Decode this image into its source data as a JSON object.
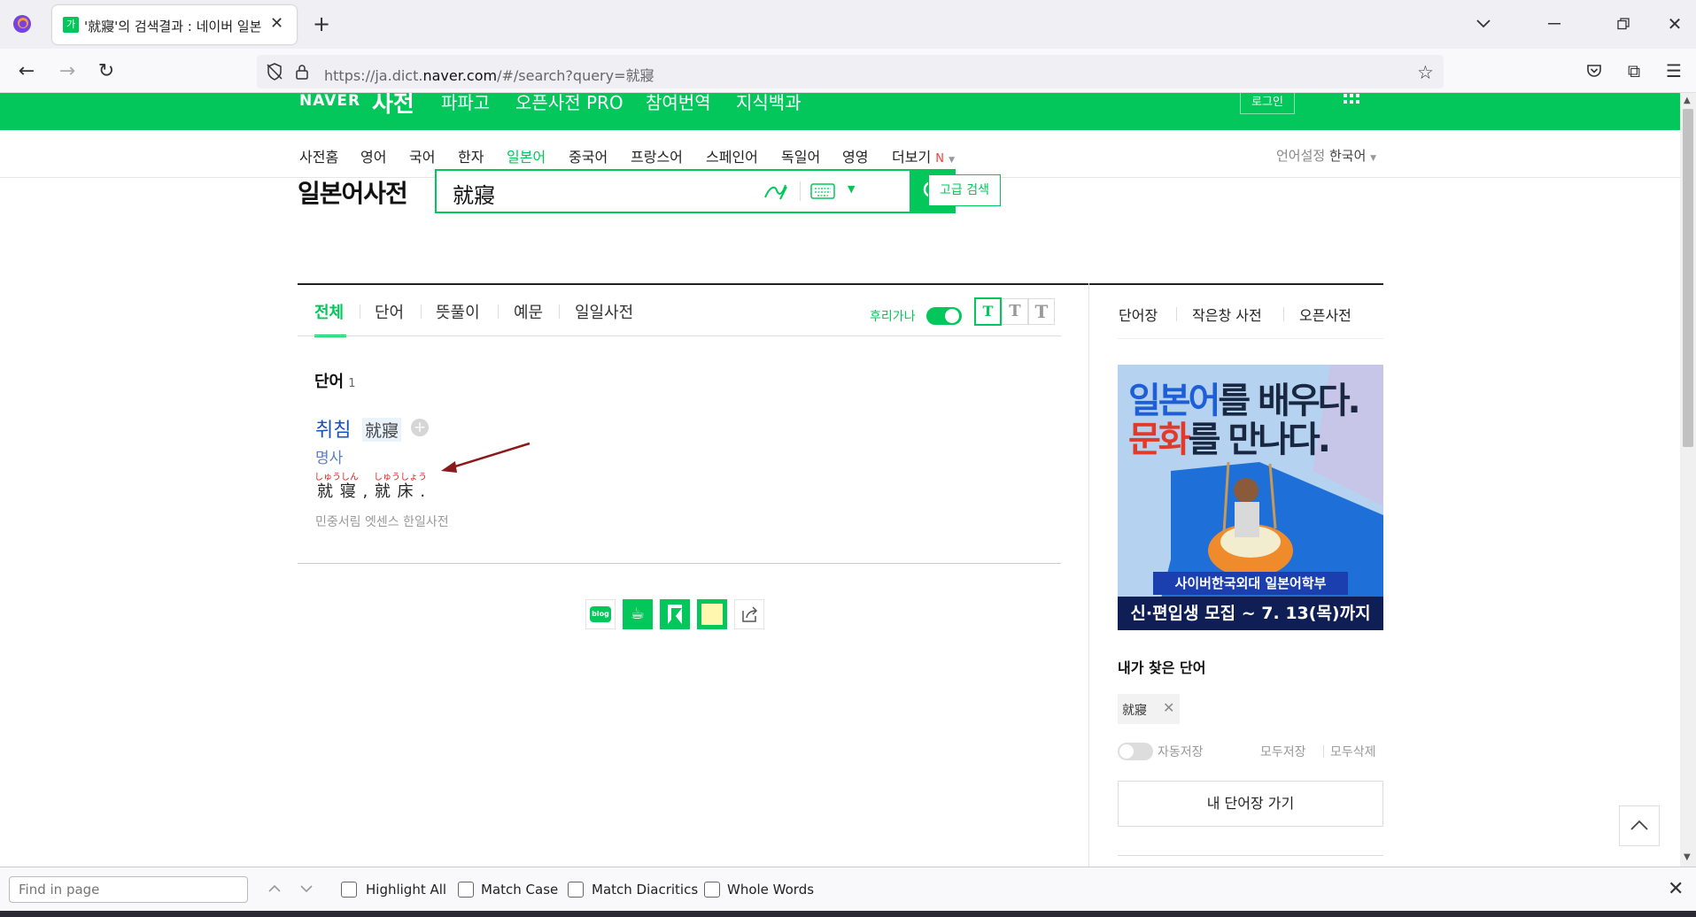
{
  "browser": {
    "tab_title": "'就寢'의 검색결과 : 네이버 일본",
    "tab_favicon": "가",
    "url_prefix": "https://ja.dict.",
    "url_domain": "naver.com",
    "url_suffix": "/#/search?query=就寢"
  },
  "header": {
    "naver_logo": "NAVER",
    "dict_label": "사전",
    "links": [
      "파파고",
      "오픈사전 PRO",
      "참여번역",
      "지식백과"
    ],
    "login_label": "로그인"
  },
  "nav": {
    "items": [
      "사전홈",
      "영어",
      "국어",
      "한자",
      "일본어",
      "중국어",
      "프랑스어",
      "스페인어",
      "독일어",
      "영영",
      "더보기"
    ],
    "more_badge": "N",
    "lang_setting_label": "언어설정",
    "lang_setting_value": "한국어"
  },
  "search": {
    "title": "일본어사전",
    "query": "就寢",
    "advanced_label": "고급 검색"
  },
  "result_tabs": {
    "tabs": [
      "전체",
      "단어",
      "뜻풀이",
      "예문",
      "일일사전"
    ],
    "furigana_label": "후리가나",
    "font_sizes": [
      "T",
      "T",
      "T"
    ]
  },
  "results": {
    "section_title": "단어",
    "section_count": "1",
    "entry_word": "취침",
    "entry_hanja": "就寢",
    "entry_pos": "명사",
    "furigana_1": "しゅうしん",
    "furigana_2": "しゅうしょう",
    "meaning": "就 寝 , 就 床 .",
    "source": "민중서림 엣센스 한일사전",
    "share_blog": "blog"
  },
  "side": {
    "tabs": [
      "단어장",
      "작은창 사전",
      "오픈사전"
    ],
    "ad_line1_a": "일본어",
    "ad_line1_b": "를 배우다.",
    "ad_line2_a": "문화",
    "ad_line2_b": "를 만나다.",
    "ad_banner1": "사이버한국외대 일본어학부",
    "ad_banner2": "신·편입생 모집 ~ 7. 13(목)까지",
    "my_words_title": "내가 찾은 단어",
    "my_word": "就寢",
    "autosave_label": "자동저장",
    "save_all_label": "모두저장",
    "delete_all_label": "모두삭제",
    "go_wordbook_label": "내 단어장 가기"
  },
  "findbar": {
    "placeholder": "Find in page",
    "options": [
      "Highlight All",
      "Match Case",
      "Match Diacritics",
      "Whole Words"
    ]
  },
  "colors": {
    "naver_green": "#03c75a",
    "link_blue": "#1a4fbf",
    "annotation_arrow": "#8b1a1a",
    "furigana_red": "#e02020"
  }
}
